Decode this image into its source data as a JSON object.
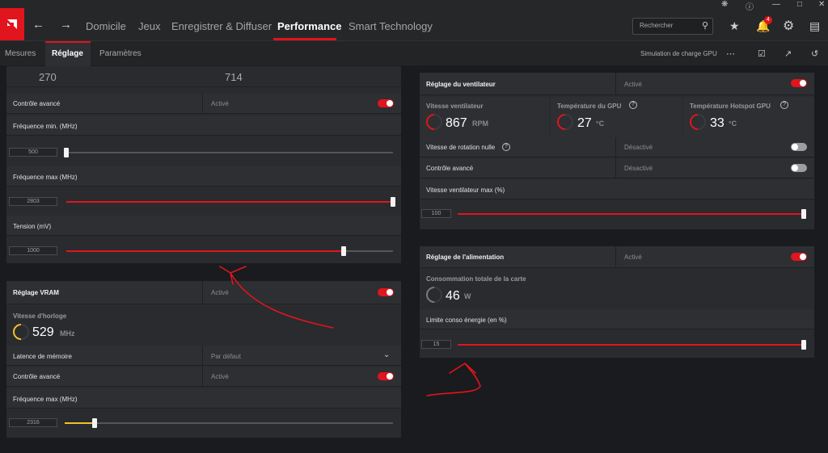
{
  "nav": {
    "items": [
      "Domicile",
      "Jeux",
      "Enregistrer & Diffuser",
      "Performance",
      "Smart Technology"
    ],
    "search_placeholder": "Rechercher",
    "notification_count": "4"
  },
  "subnav": {
    "tabs": [
      "Mesures",
      "Réglage",
      "Paramètres"
    ],
    "sim_label": "Simulation de charge GPU"
  },
  "left": {
    "top_partial_1": "270",
    "top_partial_2": "714",
    "advanced_label": "Contrôle avancé",
    "advanced_value": "Activé",
    "freq_min_label": "Fréquence min. (MHz)",
    "freq_min_value": "500",
    "freq_max_label": "Fréquence max (MHz)",
    "freq_max_value": "2803",
    "voltage_label": "Tension (mV)",
    "voltage_value": "1000",
    "slider_levels": {
      "freq_min": 0.0,
      "freq_max": 1.0,
      "voltage": 0.85
    }
  },
  "vram": {
    "title": "Réglage VRAM",
    "title_value": "Activé",
    "clock_label": "Vitesse d'horloge",
    "clock_value": "529",
    "clock_unit": "MHz",
    "latency_label": "Latence de mémoire",
    "latency_value": "Par défaut",
    "advanced_label": "Contrôle avancé",
    "advanced_value": "Activé",
    "freq_max_label": "Fréquence max (MHz)",
    "freq_max_value": "2316",
    "slider_level": 0.09
  },
  "fan": {
    "title": "Réglage du ventilateur",
    "title_value": "Activé",
    "speed_label": "Vitesse ventilateur",
    "speed_value": "867",
    "speed_unit": "RPM",
    "gpu_temp_label": "Température du GPU",
    "gpu_temp_value": "27",
    "gpu_temp_unit": "°C",
    "hotspot_label": "Température Hotspot GPU",
    "hotspot_value": "33",
    "hotspot_unit": "°C",
    "zero_rpm_label": "Vitesse de rotation nulle",
    "zero_rpm_value": "Désactivé",
    "advanced_label": "Contrôle avancé",
    "advanced_value": "Désactivé",
    "max_label": "Vitesse ventilateur max (%)",
    "max_value": "100",
    "max_level": 1.0
  },
  "power": {
    "title": "Réglage de l'alimentation",
    "title_value": "Activé",
    "consumption_label": "Consommation totale de la carte",
    "consumption_value": "46",
    "consumption_unit": "W",
    "limit_label": "Limite conso énergie (en %)",
    "limit_value": "15",
    "limit_level": 1.0
  },
  "colors": {
    "accent": "#e0151d",
    "vram_accent": "#f4c12b",
    "background": "#1a1b1e"
  }
}
